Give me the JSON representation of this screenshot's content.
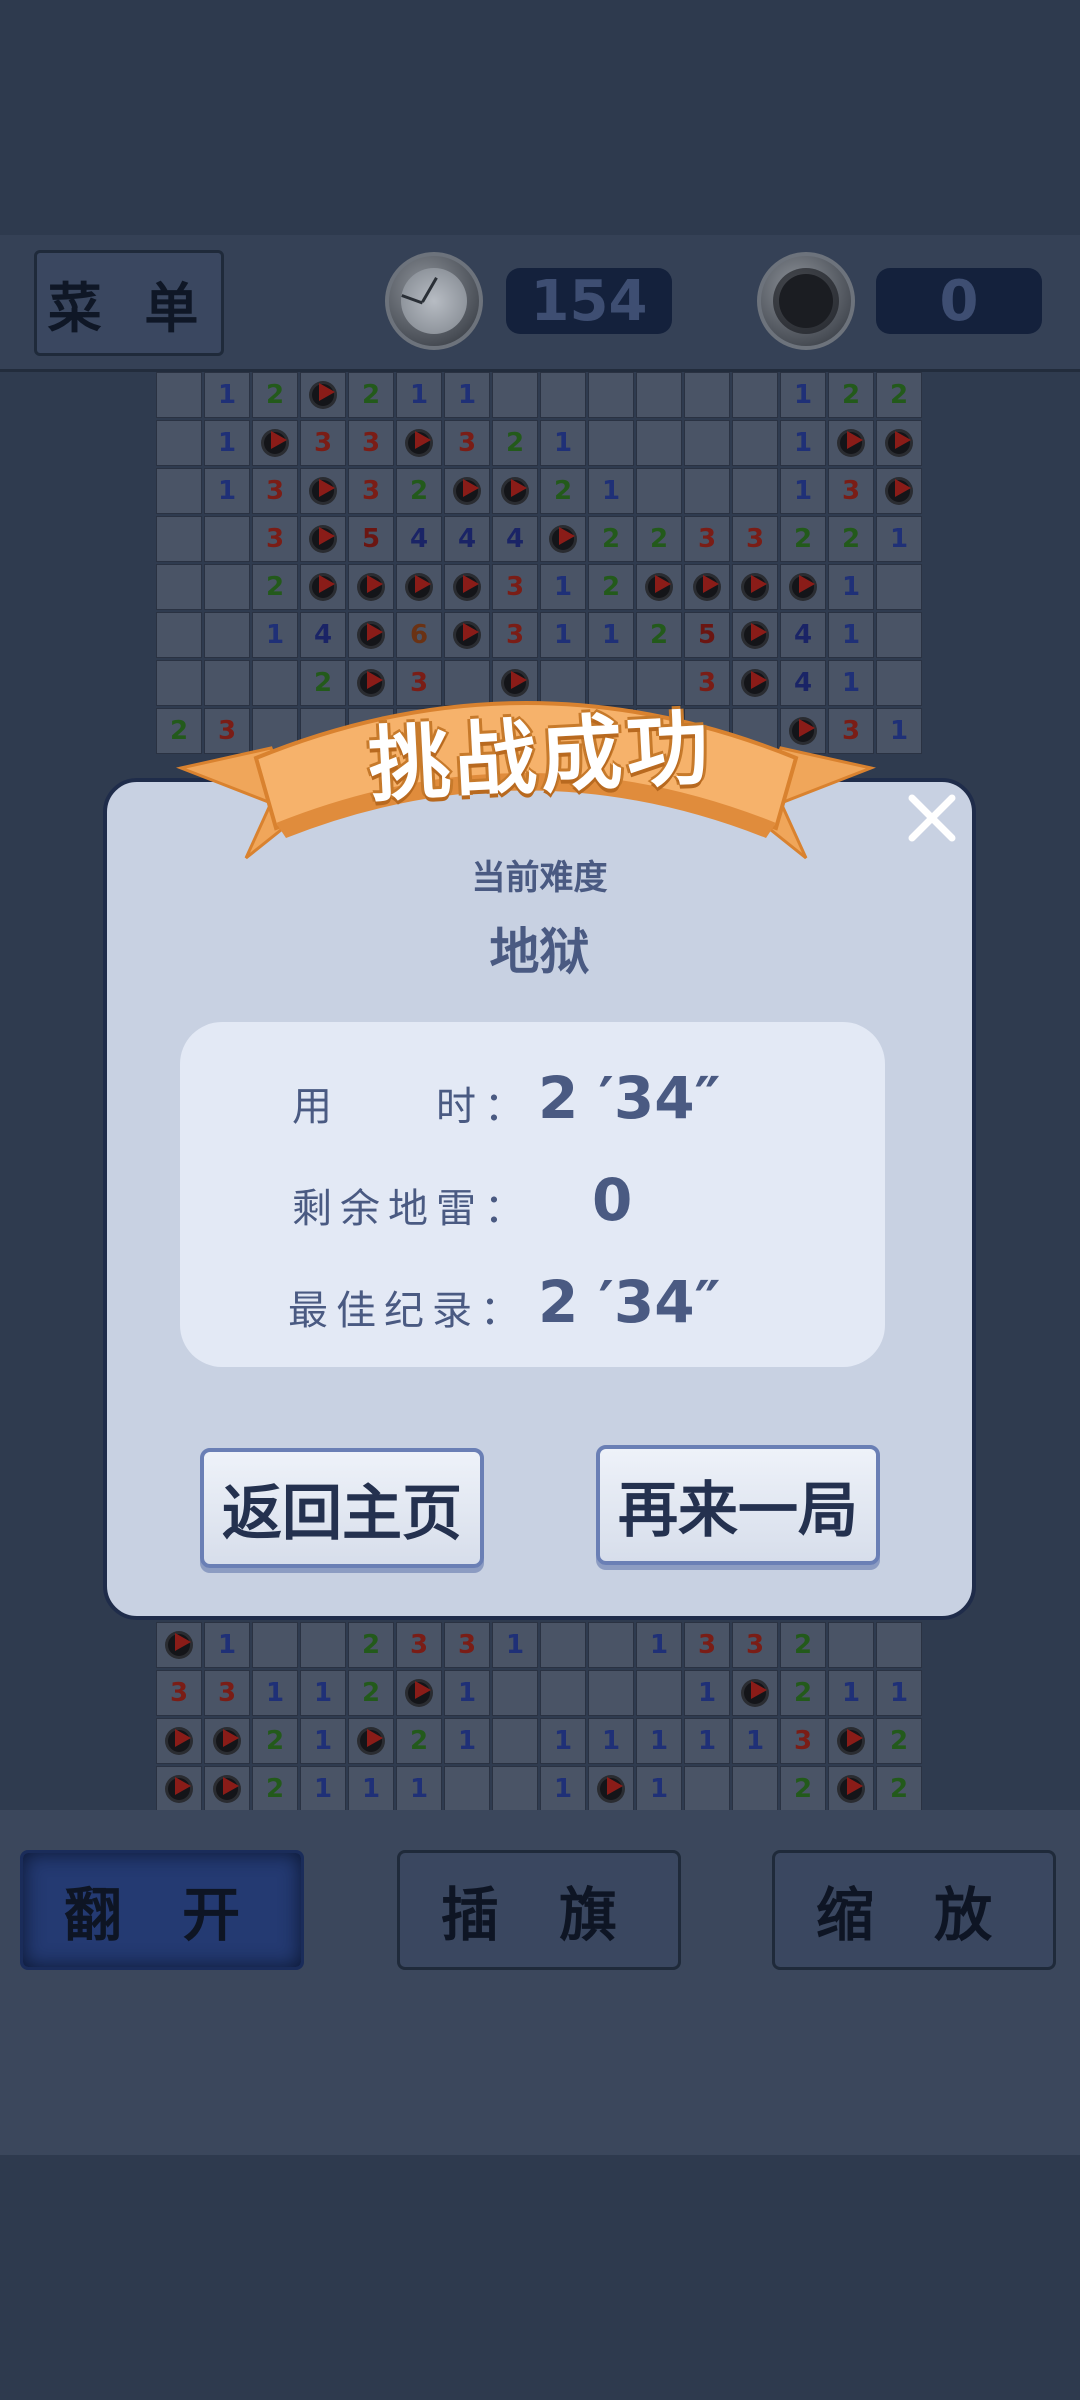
{
  "header": {
    "menu_label": "菜 单",
    "timer_value": "154",
    "mines_value": "0"
  },
  "board": {
    "visible_rows_top": [
      [
        "",
        "1",
        "2",
        "F",
        "2",
        "1",
        "1",
        "",
        "",
        "",
        "",
        "",
        "",
        "1",
        "2",
        "2"
      ],
      [
        "",
        "1",
        "F",
        "3",
        "3",
        "F",
        "3",
        "2",
        "1",
        "",
        "",
        "",
        "",
        "1",
        "F",
        "F"
      ],
      [
        "",
        "1",
        "3",
        "F",
        "3",
        "2",
        "F",
        "F",
        "2",
        "1",
        "",
        "",
        "",
        "1",
        "3",
        "F"
      ],
      [
        "",
        "",
        "3",
        "F",
        "5",
        "4",
        "4",
        "4",
        "F",
        "2",
        "2",
        "3",
        "3",
        "2",
        "2",
        "1"
      ],
      [
        "",
        "",
        "2",
        "F",
        "F",
        "F",
        "F",
        "3",
        "1",
        "2",
        "F",
        "F",
        "F",
        "F",
        "1",
        ""
      ],
      [
        "",
        "",
        "1",
        "4",
        "F",
        "6",
        "F",
        "3",
        "1",
        "1",
        "2",
        "5",
        "F",
        "4",
        "1",
        ""
      ],
      [
        "",
        "",
        "",
        "2",
        "F",
        "3",
        "",
        "F",
        "",
        "",
        "",
        "3",
        "F",
        "4",
        "1",
        ""
      ],
      [
        "2",
        "3",
        "",
        "",
        "",
        "",
        "",
        "",
        "",
        "",
        "",
        "",
        "",
        "F",
        "3",
        "1"
      ]
    ],
    "visible_rows_bottom": [
      [
        "F",
        "1",
        "",
        "",
        "2",
        "3",
        "3",
        "1",
        "",
        "",
        "1",
        "3",
        "3",
        "2",
        "",
        ""
      ],
      [
        "3",
        "3",
        "1",
        "1",
        "2",
        "F",
        "1",
        "",
        "",
        "",
        "",
        "1",
        "F",
        "2",
        "1",
        "1"
      ],
      [
        "F",
        "F",
        "2",
        "1",
        "F",
        "2",
        "1",
        "",
        "1",
        "1",
        "1",
        "1",
        "1",
        "3",
        "F",
        "2"
      ],
      [
        "F",
        "F",
        "2",
        "1",
        "1",
        "1",
        "",
        "",
        "1",
        "F",
        "1",
        "",
        "",
        "2",
        "F",
        "2"
      ]
    ]
  },
  "actions": {
    "reveal_label": "翻 开",
    "flag_label": "插 旗",
    "zoom_label": "缩 放"
  },
  "dialog": {
    "banner_title": "挑战成功",
    "difficulty_label": "当前难度",
    "difficulty_value": "地狱",
    "time_label": "用　　时：",
    "time_value": "2 ′34″",
    "remaining_label": "剩余地雷：",
    "remaining_value": "0",
    "best_label": "最佳纪录：",
    "best_value": "2 ′34″",
    "home_button": "返回主页",
    "again_button": "再来一局"
  },
  "colors": {
    "dialog_bg": "#c8d1e2",
    "dialog_text": "#4a5a82",
    "ribbon": "#f0a65a"
  }
}
